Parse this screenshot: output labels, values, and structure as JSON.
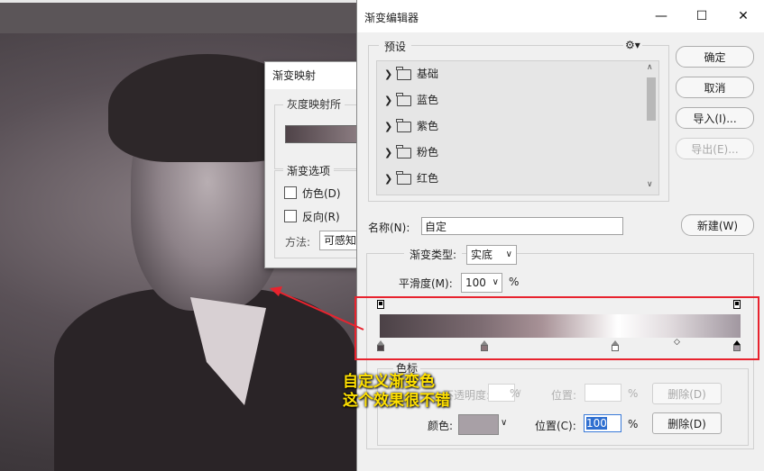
{
  "gradient_map_dialog": {
    "title": "渐变映射",
    "group1_label": "灰度映射所",
    "group2_label": "渐变选项",
    "dither_label": "仿色(D)",
    "reverse_label": "反向(R)",
    "method_label": "方法:",
    "method_value": "可感知"
  },
  "gradient_editor": {
    "title": "渐变编辑器",
    "presets": {
      "label": "预设",
      "gear_icon": "gear-icon",
      "folders": [
        "基础",
        "蓝色",
        "紫色",
        "粉色",
        "红色"
      ]
    },
    "buttons": {
      "ok": "确定",
      "cancel": "取消",
      "import": "导入(I)...",
      "export": "导出(E)...",
      "new": "新建(W)"
    },
    "name_label": "名称(N):",
    "name_value": "自定",
    "gradient_type_label": "渐变类型:",
    "gradient_type_value": "实底",
    "smoothness_label": "平滑度(M):",
    "smoothness_value": "100",
    "smoothness_unit": "%",
    "color_stops": {
      "group_label": "色标",
      "opacity_label": "不透明度:",
      "opacity_unit": "%",
      "position_label_top": "位置:",
      "position_unit_top": "%",
      "delete_label_top": "删除(D)",
      "color_label": "颜色:",
      "position_label": "位置(C):",
      "position_value": "100",
      "position_unit": "%",
      "delete_label": "删除(D)"
    },
    "colors": {
      "gradient_start": "#4b4146",
      "gradient_end": "#a197a0",
      "stop_color": "#a8a0a6",
      "highlight": "#e8232e"
    }
  },
  "annotation": {
    "line1": "自定义渐变色",
    "line2": "这个效果很不错"
  }
}
